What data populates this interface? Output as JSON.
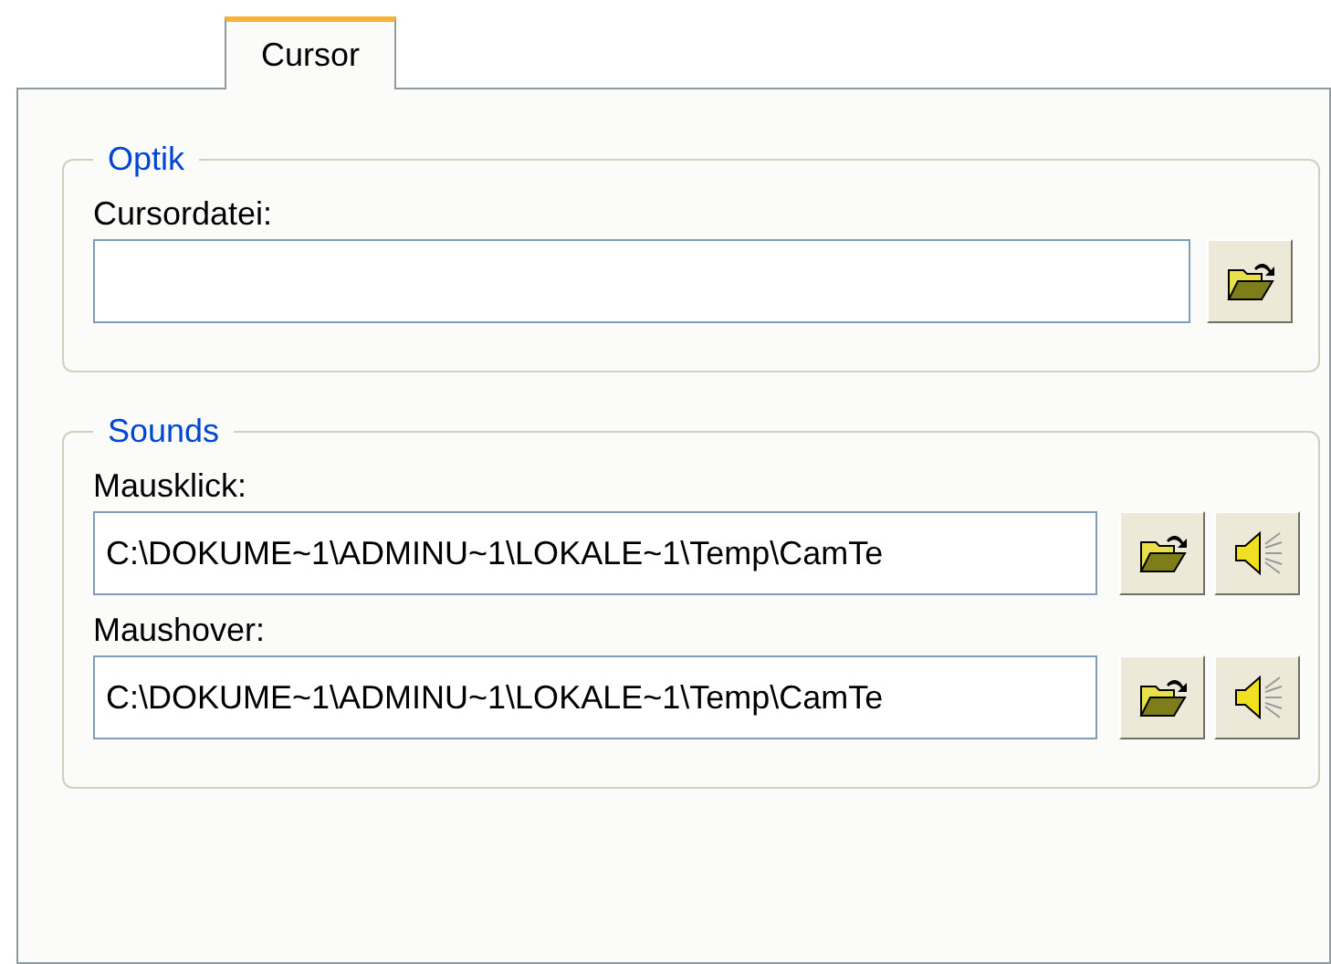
{
  "tabs": [
    {
      "label": "Cursor",
      "selected": true
    }
  ],
  "groups": [
    {
      "title": "Optik",
      "fields": [
        {
          "label": "Cursordatei:",
          "buttons": [
            {
              "kind": "browse"
            }
          ]
        }
      ]
    },
    {
      "title": "Sounds",
      "fields": [
        {
          "label": "Mausklick:",
          "value": "C:\\DOKUME~1\\ADMINU~1\\LOKALE~1\\Temp\\CamTe",
          "buttons": [
            {
              "kind": "browse"
            },
            {
              "kind": "play"
            }
          ]
        },
        {
          "label": "Maushover:",
          "value": "C:\\DOKUME~1\\ADMINU~1\\LOKALE~1\\Temp\\CamTe",
          "buttons": [
            {
              "kind": "browse"
            },
            {
              "kind": "play"
            }
          ]
        }
      ]
    }
  ]
}
